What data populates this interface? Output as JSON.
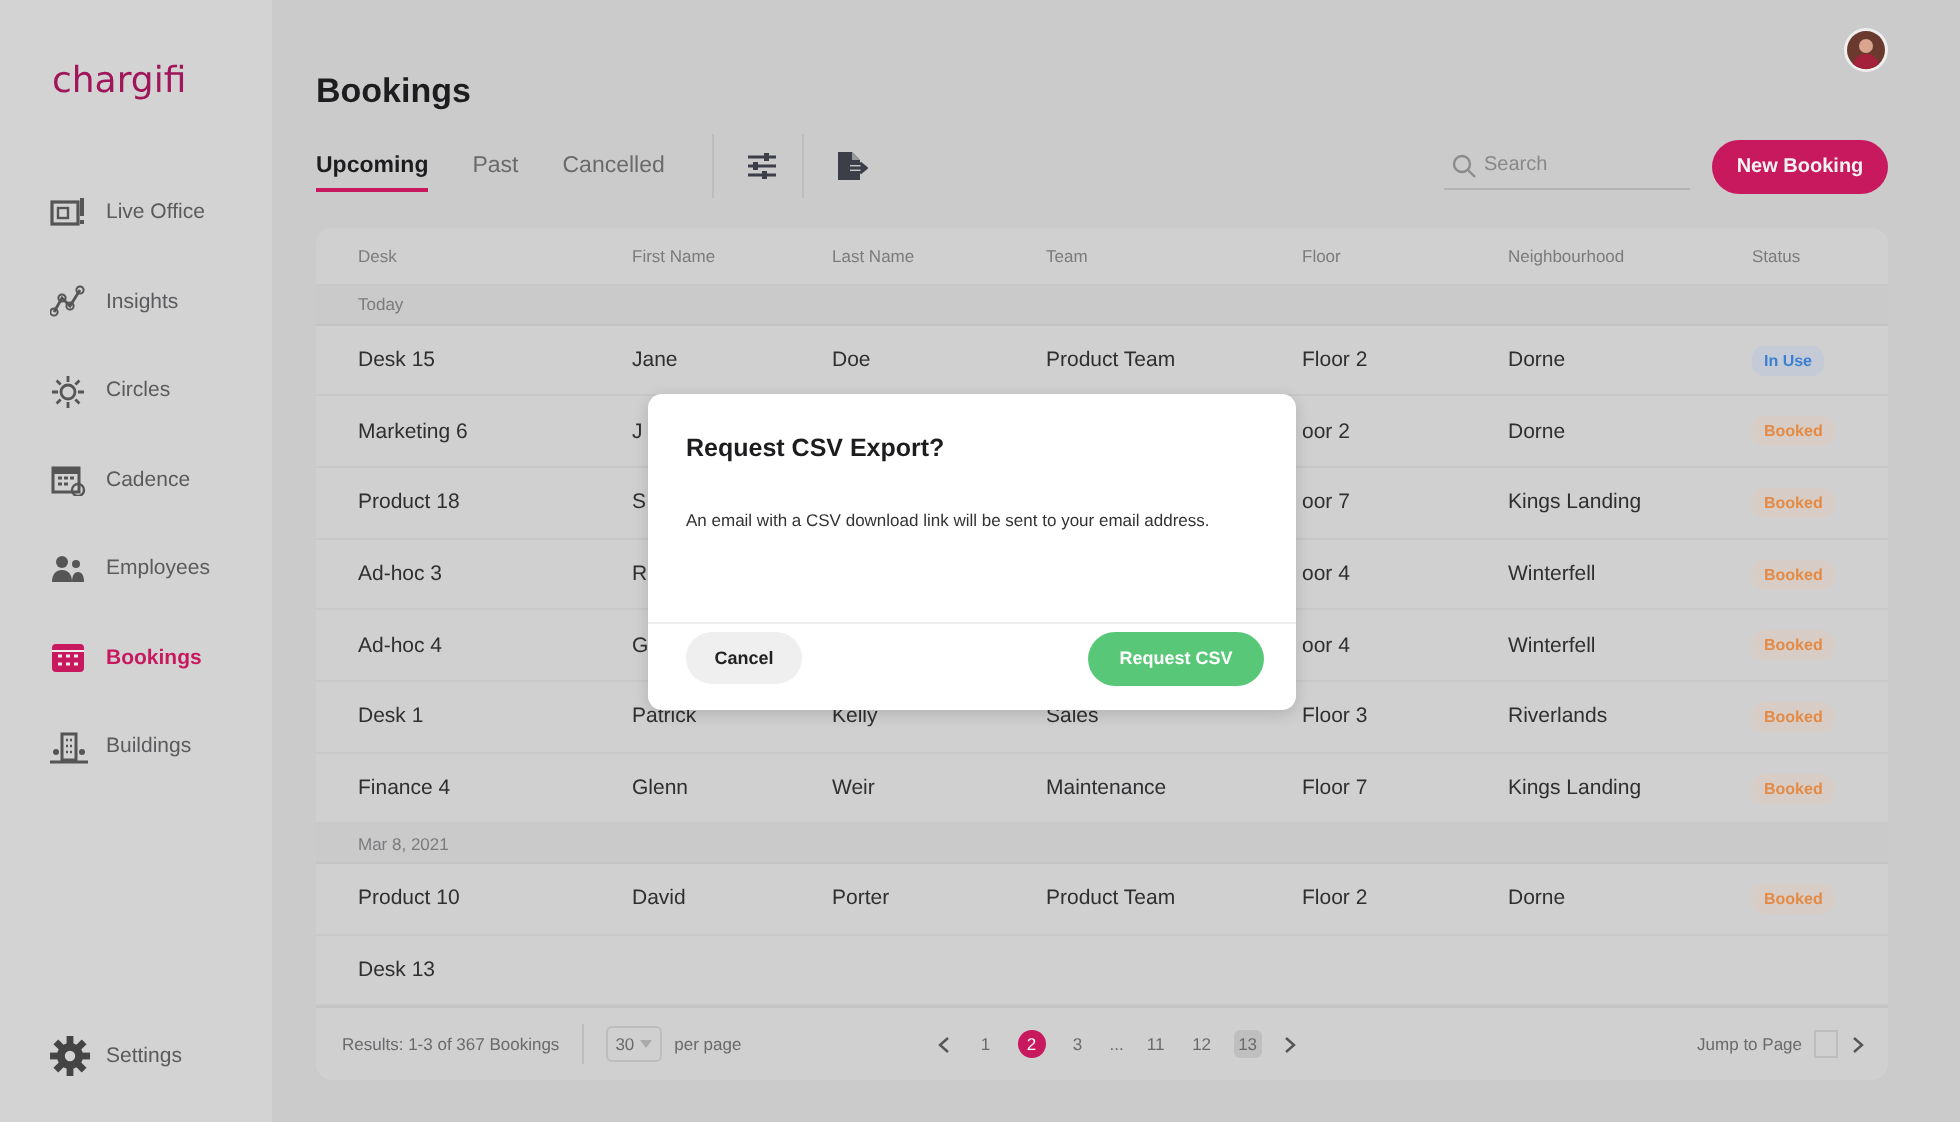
{
  "sidebar": {
    "logo": "chargifi",
    "items": [
      {
        "label": "Live Office",
        "selected": false
      },
      {
        "label": "Insights",
        "selected": false
      },
      {
        "label": "Circles",
        "selected": false
      },
      {
        "label": "Cadence",
        "selected": false
      },
      {
        "label": "Employees",
        "selected": false
      },
      {
        "label": "Bookings",
        "selected": true
      },
      {
        "label": "Buildings",
        "selected": false
      }
    ],
    "settings": "Settings"
  },
  "header": {
    "title": "Bookings",
    "tabs": [
      {
        "label": "Upcoming",
        "selected": true
      },
      {
        "label": "Past",
        "selected": false
      },
      {
        "label": "Cancelled",
        "selected": false
      }
    ],
    "search": {
      "placeholder": "Search"
    },
    "new_button": "New Booking"
  },
  "table": {
    "columns": [
      "Desk",
      "First Name",
      "Last Name",
      "Team",
      "Floor",
      "Neighbourhood",
      "Status"
    ],
    "groups": [
      {
        "label": "Today",
        "rows": [
          {
            "desk": "Desk 15",
            "first_name": "Jane",
            "last_name": "Doe",
            "team": "Product Team",
            "floor": "Floor 2",
            "neighbourhood": "Dorne",
            "status": {
              "text": "In Use",
              "kind": "in_use"
            }
          },
          {
            "desk": "Marketing 6",
            "first_name": "J",
            "floor": "oor 2",
            "neighbourhood": "Dorne",
            "status": {
              "text": "Booked",
              "kind": "booked"
            }
          },
          {
            "desk": "Product 18",
            "first_name": "S",
            "floor": "oor 7",
            "neighbourhood": "Kings Landing",
            "status": {
              "text": "Booked",
              "kind": "booked"
            }
          },
          {
            "desk": "Ad-hoc 3",
            "first_name": "R",
            "floor": "oor 4",
            "neighbourhood": "Winterfell",
            "status": {
              "text": "Booked",
              "kind": "booked"
            }
          },
          {
            "desk": "Ad-hoc 4",
            "first_name": "G",
            "floor": "oor 4",
            "neighbourhood": "Winterfell",
            "status": {
              "text": "Booked",
              "kind": "booked"
            }
          },
          {
            "desk": "Desk 1",
            "first_name": "Patrick",
            "last_name": "Kelly",
            "team": "Sales",
            "floor": "Floor 3",
            "neighbourhood": "Riverlands",
            "status": {
              "text": "Booked",
              "kind": "booked"
            }
          },
          {
            "desk": "Finance 4",
            "first_name": "Glenn",
            "last_name": "Weir",
            "team": "Maintenance",
            "floor": "Floor 7",
            "neighbourhood": "Kings Landing",
            "status": {
              "text": "Booked",
              "kind": "booked"
            }
          }
        ]
      },
      {
        "label": "Mar 8, 2021",
        "rows": [
          {
            "desk": "Product 10",
            "first_name": "David",
            "last_name": "Porter",
            "team": "Product Team",
            "floor": "Floor 2",
            "neighbourhood": "Dorne",
            "status": {
              "text": "Booked",
              "kind": "booked"
            }
          },
          {
            "desk": "Desk 13"
          }
        ]
      }
    ],
    "footer": {
      "results": "Results: 1-3 of 367 Bookings",
      "per_page_value": "30",
      "per_page_label": "per page",
      "pages": [
        {
          "label": "1",
          "selected": false,
          "hovered": false
        },
        {
          "label": "2",
          "selected": true,
          "hovered": false
        },
        {
          "label": "3",
          "selected": false,
          "hovered": false
        },
        {
          "label": "...",
          "kind": "gap"
        },
        {
          "label": "11",
          "selected": false,
          "hovered": false
        },
        {
          "label": "12",
          "selected": false,
          "hovered": false
        },
        {
          "label": "13",
          "selected": false,
          "hovered": true
        }
      ],
      "jump_label": "Jump to Page"
    }
  },
  "modal": {
    "title": "Request CSV Export?",
    "body": "An email with a CSV download link will be sent to your email address.",
    "cancel": "Cancel",
    "confirm": "Request CSV"
  }
}
